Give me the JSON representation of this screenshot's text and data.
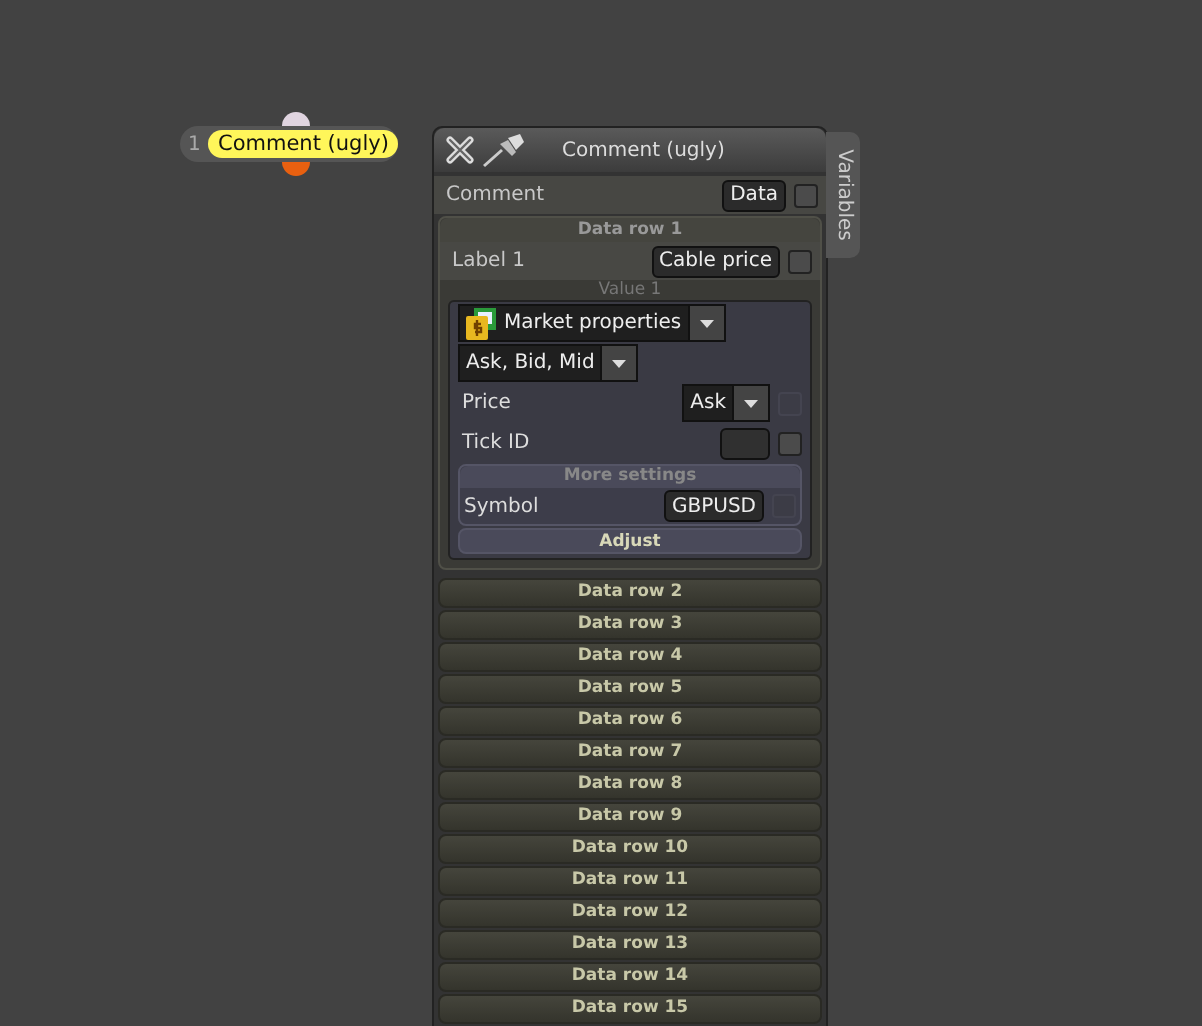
{
  "node": {
    "number": "1",
    "label": "Comment (ugly)"
  },
  "panel": {
    "title": "Comment (ugly)",
    "side_tab": "Variables",
    "comment_row": {
      "label": "Comment",
      "button": "Data",
      "checkbox": {
        "checked": false,
        "disabled": false
      }
    },
    "data_row_1": {
      "title": "Data row 1",
      "expanded": true,
      "label_row": {
        "label": "Label 1",
        "button": "Cable price",
        "checkbox": {
          "checked": false,
          "disabled": false
        }
      },
      "value_title": "Value 1",
      "source_dropdown": "Market properties",
      "mode_dropdown": "Ask, Bid, Mid",
      "fields": [
        {
          "label": "Price",
          "kind": "dropdown",
          "value": "Ask",
          "checkbox": {
            "checked": false,
            "disabled": true
          }
        },
        {
          "label": "Tick ID",
          "kind": "button",
          "checkbox": {
            "checked": false,
            "disabled": false
          }
        }
      ],
      "more_settings": {
        "title": "More settings",
        "label": "Symbol",
        "value": "GBPUSD",
        "checkbox": {
          "checked": false,
          "disabled": true
        }
      },
      "adjust": "Adjust"
    },
    "collapsed_rows": [
      "Data row 2",
      "Data row 3",
      "Data row 4",
      "Data row 5",
      "Data row 6",
      "Data row 7",
      "Data row 8",
      "Data row 9",
      "Data row 10",
      "Data row 11",
      "Data row 12",
      "Data row 13",
      "Data row 14",
      "Data row 15"
    ]
  }
}
